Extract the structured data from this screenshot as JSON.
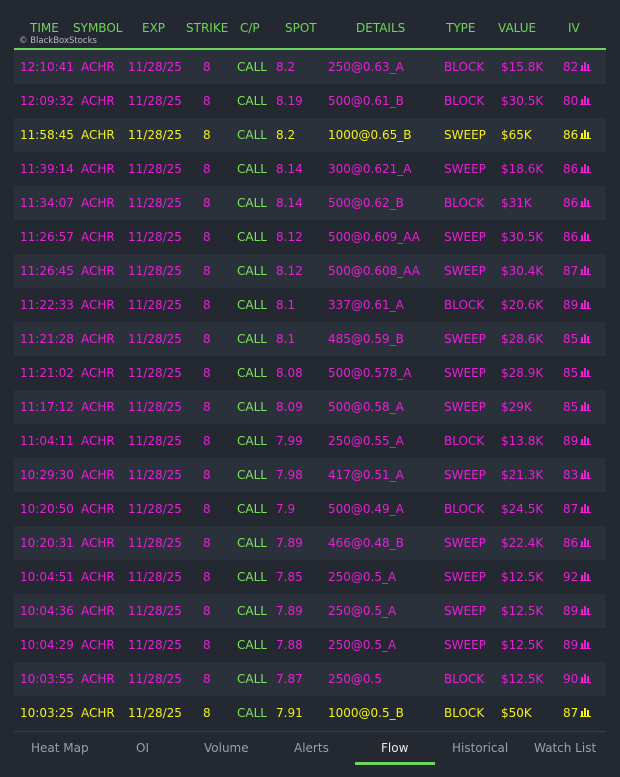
{
  "header": {
    "columns": [
      "TIME",
      "SYMBOL",
      "EXP",
      "STRIKE",
      "C/P",
      "SPOT",
      "DETAILS",
      "TYPE",
      "VALUE",
      "IV"
    ],
    "watermark": "© BlackBoxStocks"
  },
  "colors": {
    "magenta": "#e81fd6",
    "yellow": "#f2f21f",
    "green": "#7ee35c",
    "accent": "#6fd65c"
  },
  "rows": [
    {
      "time": "12:10:41",
      "symbol": "ACHR",
      "exp": "11/28/25",
      "strike": "8",
      "cp": "CALL",
      "spot": "8.2",
      "details": "250@0.63_A",
      "type": "BLOCK",
      "value": "$15.8K",
      "iv": "82",
      "highlight": "magenta"
    },
    {
      "time": "12:09:32",
      "symbol": "ACHR",
      "exp": "11/28/25",
      "strike": "8",
      "cp": "CALL",
      "spot": "8.19",
      "details": "500@0.61_B",
      "type": "BLOCK",
      "value": "$30.5K",
      "iv": "80",
      "highlight": "magenta"
    },
    {
      "time": "11:58:45",
      "symbol": "ACHR",
      "exp": "11/28/25",
      "strike": "8",
      "cp": "CALL",
      "spot": "8.2",
      "details": "1000@0.65_B",
      "type": "SWEEP",
      "value": "$65K",
      "iv": "86",
      "highlight": "yellow"
    },
    {
      "time": "11:39:14",
      "symbol": "ACHR",
      "exp": "11/28/25",
      "strike": "8",
      "cp": "CALL",
      "spot": "8.14",
      "details": "300@0.621_A",
      "type": "SWEEP",
      "value": "$18.6K",
      "iv": "86",
      "highlight": "magenta"
    },
    {
      "time": "11:34:07",
      "symbol": "ACHR",
      "exp": "11/28/25",
      "strike": "8",
      "cp": "CALL",
      "spot": "8.14",
      "details": "500@0.62_B",
      "type": "BLOCK",
      "value": "$31K",
      "iv": "86",
      "highlight": "magenta"
    },
    {
      "time": "11:26:57",
      "symbol": "ACHR",
      "exp": "11/28/25",
      "strike": "8",
      "cp": "CALL",
      "spot": "8.12",
      "details": "500@0.609_AA",
      "type": "SWEEP",
      "value": "$30.5K",
      "iv": "86",
      "highlight": "magenta"
    },
    {
      "time": "11:26:45",
      "symbol": "ACHR",
      "exp": "11/28/25",
      "strike": "8",
      "cp": "CALL",
      "spot": "8.12",
      "details": "500@0.608_AA",
      "type": "SWEEP",
      "value": "$30.4K",
      "iv": "87",
      "highlight": "magenta"
    },
    {
      "time": "11:22:33",
      "symbol": "ACHR",
      "exp": "11/28/25",
      "strike": "8",
      "cp": "CALL",
      "spot": "8.1",
      "details": "337@0.61_A",
      "type": "BLOCK",
      "value": "$20.6K",
      "iv": "89",
      "highlight": "magenta"
    },
    {
      "time": "11:21:28",
      "symbol": "ACHR",
      "exp": "11/28/25",
      "strike": "8",
      "cp": "CALL",
      "spot": "8.1",
      "details": "485@0.59_B",
      "type": "SWEEP",
      "value": "$28.6K",
      "iv": "85",
      "highlight": "magenta"
    },
    {
      "time": "11:21:02",
      "symbol": "ACHR",
      "exp": "11/28/25",
      "strike": "8",
      "cp": "CALL",
      "spot": "8.08",
      "details": "500@0.578_A",
      "type": "SWEEP",
      "value": "$28.9K",
      "iv": "85",
      "highlight": "magenta"
    },
    {
      "time": "11:17:12",
      "symbol": "ACHR",
      "exp": "11/28/25",
      "strike": "8",
      "cp": "CALL",
      "spot": "8.09",
      "details": "500@0.58_A",
      "type": "SWEEP",
      "value": "$29K",
      "iv": "85",
      "highlight": "magenta"
    },
    {
      "time": "11:04:11",
      "symbol": "ACHR",
      "exp": "11/28/25",
      "strike": "8",
      "cp": "CALL",
      "spot": "7.99",
      "details": "250@0.55_A",
      "type": "BLOCK",
      "value": "$13.8K",
      "iv": "89",
      "highlight": "magenta"
    },
    {
      "time": "10:29:30",
      "symbol": "ACHR",
      "exp": "11/28/25",
      "strike": "8",
      "cp": "CALL",
      "spot": "7.98",
      "details": "417@0.51_A",
      "type": "SWEEP",
      "value": "$21.3K",
      "iv": "83",
      "highlight": "magenta"
    },
    {
      "time": "10:20:50",
      "symbol": "ACHR",
      "exp": "11/28/25",
      "strike": "8",
      "cp": "CALL",
      "spot": "7.9",
      "details": "500@0.49_A",
      "type": "BLOCK",
      "value": "$24.5K",
      "iv": "87",
      "highlight": "magenta"
    },
    {
      "time": "10:20:31",
      "symbol": "ACHR",
      "exp": "11/28/25",
      "strike": "8",
      "cp": "CALL",
      "spot": "7.89",
      "details": "466@0.48_B",
      "type": "SWEEP",
      "value": "$22.4K",
      "iv": "86",
      "highlight": "magenta"
    },
    {
      "time": "10:04:51",
      "symbol": "ACHR",
      "exp": "11/28/25",
      "strike": "8",
      "cp": "CALL",
      "spot": "7.85",
      "details": "250@0.5_A",
      "type": "SWEEP",
      "value": "$12.5K",
      "iv": "92",
      "highlight": "magenta"
    },
    {
      "time": "10:04:36",
      "symbol": "ACHR",
      "exp": "11/28/25",
      "strike": "8",
      "cp": "CALL",
      "spot": "7.89",
      "details": "250@0.5_A",
      "type": "SWEEP",
      "value": "$12.5K",
      "iv": "89",
      "highlight": "magenta"
    },
    {
      "time": "10:04:29",
      "symbol": "ACHR",
      "exp": "11/28/25",
      "strike": "8",
      "cp": "CALL",
      "spot": "7.88",
      "details": "250@0.5_A",
      "type": "SWEEP",
      "value": "$12.5K",
      "iv": "89",
      "highlight": "magenta"
    },
    {
      "time": "10:03:55",
      "symbol": "ACHR",
      "exp": "11/28/25",
      "strike": "8",
      "cp": "CALL",
      "spot": "7.87",
      "details": "250@0.5",
      "type": "BLOCK",
      "value": "$12.5K",
      "iv": "90",
      "highlight": "magenta"
    },
    {
      "time": "10:03:25",
      "symbol": "ACHR",
      "exp": "11/28/25",
      "strike": "8",
      "cp": "CALL",
      "spot": "7.91",
      "details": "1000@0.5_B",
      "type": "BLOCK",
      "value": "$50K",
      "iv": "87",
      "highlight": "yellow"
    }
  ],
  "iv_icon": "bar-chart-icon",
  "tabs": [
    {
      "label": "Heat Map",
      "active": false
    },
    {
      "label": "OI",
      "active": false
    },
    {
      "label": "Volume",
      "active": false
    },
    {
      "label": "Alerts",
      "active": false
    },
    {
      "label": "Flow",
      "active": true
    },
    {
      "label": "Historical",
      "active": false
    },
    {
      "label": "Watch List",
      "active": false
    }
  ]
}
